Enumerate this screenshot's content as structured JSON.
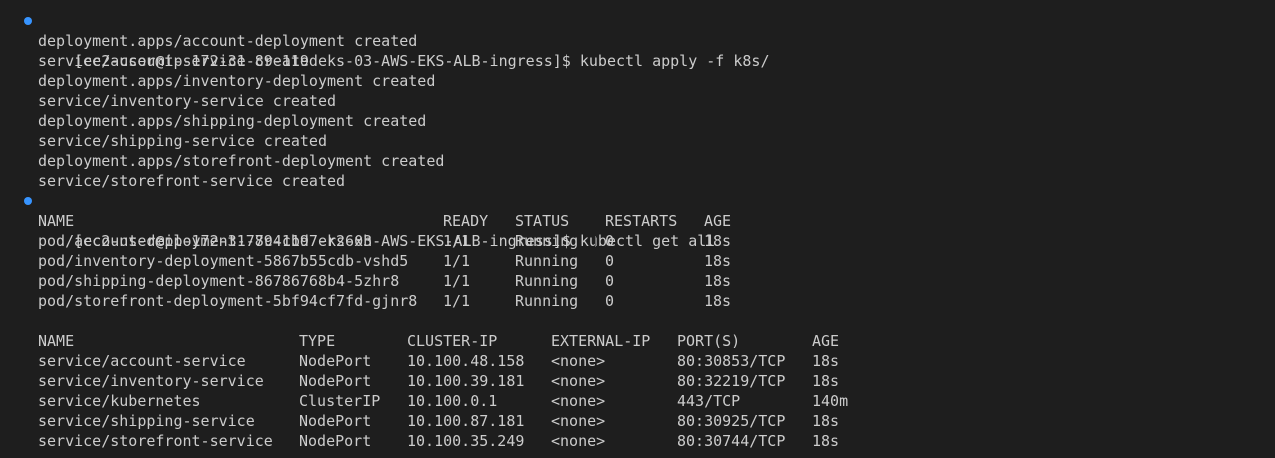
{
  "theme": {
    "background": "#1e1e1e",
    "foreground": "#cccccc",
    "prompt_dot": "#3794ff"
  },
  "commands": [
    {
      "prompt": "[ec2-user@ip-172-31-89-119 eks-03-AWS-EKS-ALB-ingress]$ kubectl apply -f k8s/",
      "output": [
        "deployment.apps/account-deployment created",
        "service/account-service created",
        "deployment.apps/inventory-deployment created",
        "service/inventory-service created",
        "deployment.apps/shipping-deployment created",
        "service/shipping-service created",
        "deployment.apps/storefront-deployment created",
        "service/storefront-service created"
      ]
    },
    {
      "prompt": "[ec2-user@ip-172-31-89-119 eks-03-AWS-EKS-ALB-ingress]$ kubectl get all"
    }
  ],
  "pods": {
    "headers": [
      "NAME",
      "READY",
      "STATUS",
      "RESTARTS",
      "AGE"
    ],
    "rows": [
      [
        "pod/account-deployment-77c4cbd7-r26xh",
        "1/1",
        "Running",
        "0",
        "18s"
      ],
      [
        "pod/inventory-deployment-5867b55cdb-vshd5",
        "1/1",
        "Running",
        "0",
        "18s"
      ],
      [
        "pod/shipping-deployment-86786768b4-5zhr8",
        "1/1",
        "Running",
        "0",
        "18s"
      ],
      [
        "pod/storefront-deployment-5bf94cf7fd-gjnr8",
        "1/1",
        "Running",
        "0",
        "18s"
      ]
    ]
  },
  "services": {
    "headers": [
      "NAME",
      "TYPE",
      "CLUSTER-IP",
      "EXTERNAL-IP",
      "PORT(S)",
      "AGE"
    ],
    "rows": [
      [
        "service/account-service",
        "NodePort",
        "10.100.48.158",
        "<none>",
        "80:30853/TCP",
        "18s"
      ],
      [
        "service/inventory-service",
        "NodePort",
        "10.100.39.181",
        "<none>",
        "80:32219/TCP",
        "18s"
      ],
      [
        "service/kubernetes",
        "ClusterIP",
        "10.100.0.1",
        "<none>",
        "443/TCP",
        "140m"
      ],
      [
        "service/shipping-service",
        "NodePort",
        "10.100.87.181",
        "<none>",
        "80:30925/TCP",
        "18s"
      ],
      [
        "service/storefront-service",
        "NodePort",
        "10.100.35.249",
        "<none>",
        "80:30744/TCP",
        "18s"
      ]
    ]
  }
}
